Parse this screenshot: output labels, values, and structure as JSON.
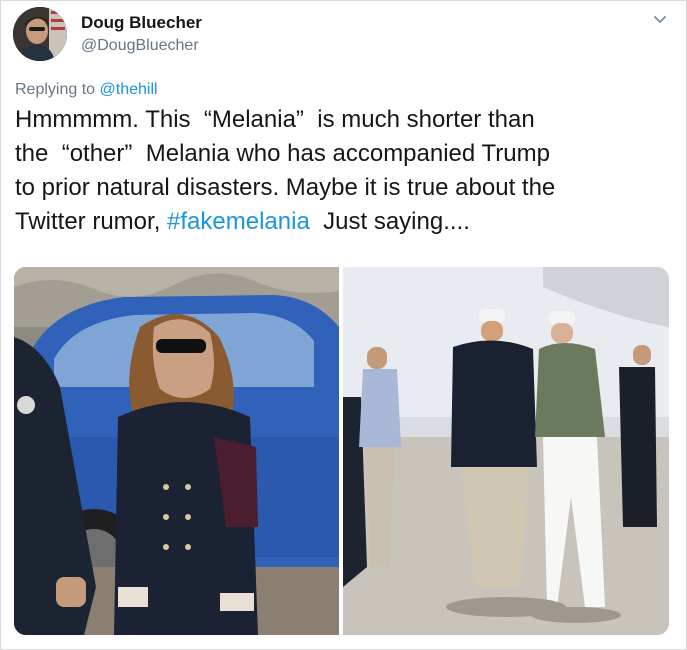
{
  "author": {
    "name": "Doug Bluecher",
    "handle": "@DougBluecher"
  },
  "reply": {
    "prefix": "Replying to ",
    "target": "@thehill"
  },
  "tweet": {
    "line1": "Hmmmmm. This  “Melania”  is much shorter than",
    "line2": "the  “other”  Melania who has accompanied Trump",
    "line3": "to prior natural disasters. Maybe it is true about the",
    "line4_pre": "Twitter rumor, ",
    "line4_hashtag": "#fakemelania",
    "line4_post": "  Just saying...."
  },
  "icons": {
    "menu": "chevron-down-icon",
    "avatar": "avatar-image"
  },
  "colors": {
    "link": "#1b95e0",
    "secondary_text": "#657786",
    "primary_text": "#14171a"
  }
}
